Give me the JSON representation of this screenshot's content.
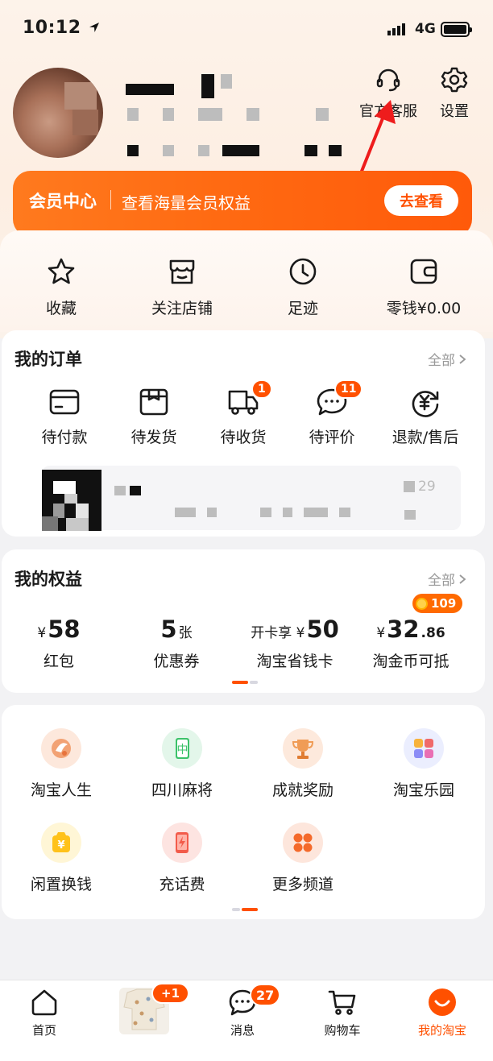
{
  "status_bar": {
    "time": "10:12",
    "network": "4G"
  },
  "header": {
    "customer_service_label": "官方客服",
    "settings_label": "设置"
  },
  "member": {
    "title": "会员中心",
    "subtitle": "查看海量会员权益",
    "button": "去查看"
  },
  "quick": [
    {
      "label": "收藏",
      "icon": "star-icon"
    },
    {
      "label": "关注店铺",
      "icon": "store-icon"
    },
    {
      "label": "足迹",
      "icon": "clock-icon"
    },
    {
      "label": "零钱¥0.00",
      "icon": "wallet-icon"
    }
  ],
  "orders": {
    "title": "我的订单",
    "more": "全部",
    "items": [
      {
        "label": "待付款",
        "icon": "card-icon",
        "badge": ""
      },
      {
        "label": "待发货",
        "icon": "package-icon",
        "badge": ""
      },
      {
        "label": "待收货",
        "icon": "truck-icon",
        "badge": "1"
      },
      {
        "label": "待评价",
        "icon": "comment-icon",
        "badge": "11"
      },
      {
        "label": "退款/售后",
        "icon": "refund-icon",
        "badge": ""
      }
    ],
    "preview_tail": "29"
  },
  "benefits": {
    "title": "我的权益",
    "more": "全部",
    "coin_badge": "109",
    "items": [
      {
        "prefix": "¥",
        "value": "58",
        "suffix": "",
        "label": "红包"
      },
      {
        "prefix": "",
        "value": "5",
        "suffix": "张",
        "label": "优惠券"
      },
      {
        "prefix": "开卡享 ¥",
        "value": "50",
        "suffix": "",
        "label": "淘宝省钱卡"
      },
      {
        "prefix": "¥",
        "value": "32",
        "suffix": ".86",
        "label": "淘金币可抵"
      }
    ]
  },
  "channels": [
    {
      "label": "淘宝人生",
      "icon": "life-icon",
      "color": "#f2a274"
    },
    {
      "label": "四川麻将",
      "icon": "mahjong-icon",
      "color": "#3cc26a"
    },
    {
      "label": "成就奖励",
      "icon": "trophy-icon",
      "color": "#f09c56"
    },
    {
      "label": "淘宝乐园",
      "icon": "grid-apps-icon",
      "color": "#8b8cf6"
    },
    {
      "label": "闲置换钱",
      "icon": "coin-bag-icon",
      "color": "#ffc21a"
    },
    {
      "label": "充话费",
      "icon": "phone-charge-icon",
      "color": "#f25b4a"
    },
    {
      "label": "更多频道",
      "icon": "more-dots-icon",
      "color": "#f46a2b"
    }
  ],
  "tabbar": {
    "home": "首页",
    "promo_badge": "+1",
    "messages": "消息",
    "messages_badge": "27",
    "cart": "购物车",
    "mine": "我的淘宝",
    "active_color": "#ff5000"
  }
}
